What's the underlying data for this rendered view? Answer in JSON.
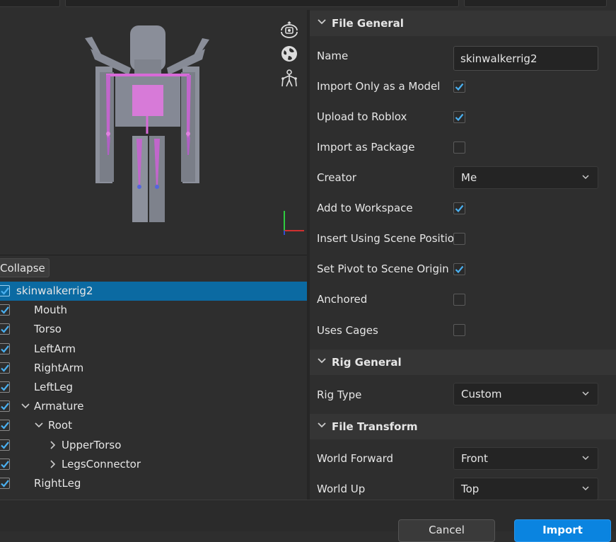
{
  "viewport": {
    "icons": [
      "rotate-camera-icon",
      "globe-icon",
      "rig-icon"
    ]
  },
  "tree": {
    "collapse_label": "Collapse",
    "items": [
      {
        "label": "skinwalkerrig2",
        "checked": true,
        "selected": true,
        "depth": 0,
        "expander": "none"
      },
      {
        "label": "Mouth",
        "checked": true,
        "depth": 1,
        "expander": "none"
      },
      {
        "label": "Torso",
        "checked": true,
        "depth": 1,
        "expander": "none"
      },
      {
        "label": "LeftArm",
        "checked": true,
        "depth": 1,
        "expander": "none"
      },
      {
        "label": "RightArm",
        "checked": true,
        "depth": 1,
        "expander": "none"
      },
      {
        "label": "LeftLeg",
        "checked": true,
        "depth": 1,
        "expander": "none"
      },
      {
        "label": "Armature",
        "checked": true,
        "depth": 1,
        "expander": "expanded"
      },
      {
        "label": "Root",
        "checked": true,
        "depth": 2,
        "expander": "expanded"
      },
      {
        "label": "UpperTorso",
        "checked": true,
        "depth": 3,
        "expander": "collapsed"
      },
      {
        "label": "LegsConnector",
        "checked": true,
        "depth": 3,
        "expander": "collapsed"
      },
      {
        "label": "RightLeg",
        "checked": true,
        "depth": 1,
        "expander": "none"
      }
    ]
  },
  "sections": {
    "file_general": "File General",
    "rig_general": "Rig General",
    "file_transform": "File Transform"
  },
  "props": {
    "name_label": "Name",
    "name_value": "skinwalkerrig2",
    "import_model_label": "Import Only as a Model",
    "import_model_checked": true,
    "upload_label": "Upload to Roblox",
    "upload_checked": true,
    "package_label": "Import as Package",
    "package_checked": false,
    "creator_label": "Creator",
    "creator_value": "Me",
    "workspace_label": "Add to Workspace",
    "workspace_checked": true,
    "scene_pos_label": "Insert Using Scene Position",
    "scene_pos_checked": false,
    "pivot_label": "Set Pivot to Scene Origin",
    "pivot_checked": true,
    "anchored_label": "Anchored",
    "anchored_checked": false,
    "cages_label": "Uses Cages",
    "cages_checked": false,
    "rig_type_label": "Rig Type",
    "rig_type_value": "Custom",
    "world_forward_label": "World Forward",
    "world_forward_value": "Front",
    "world_up_label": "World Up",
    "world_up_value": "Top"
  },
  "footer": {
    "cancel_label": "Cancel",
    "import_label": "Import"
  },
  "colors": {
    "accent": "#0b6aa2",
    "check": "#4ab0f0",
    "bone": "#d86ad8"
  }
}
